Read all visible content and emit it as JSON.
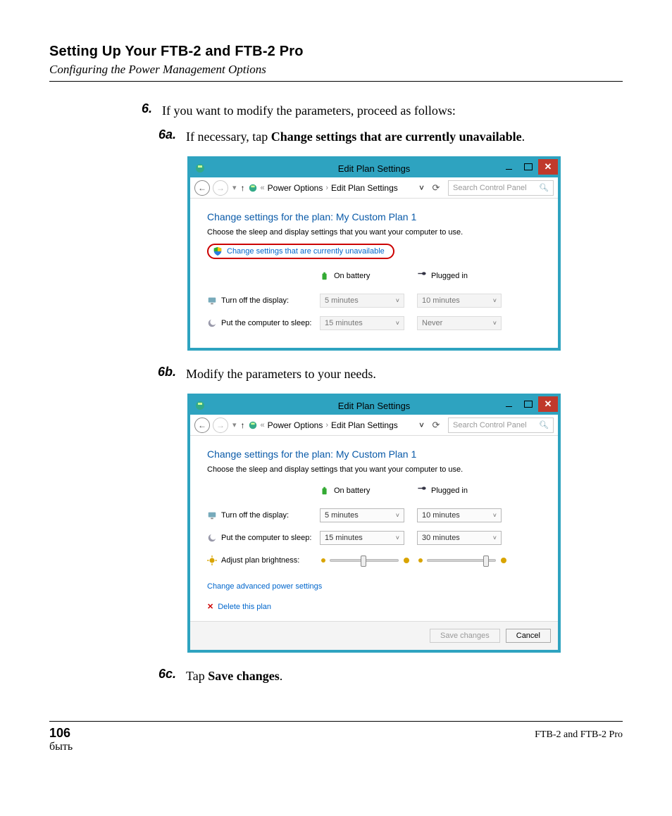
{
  "page_title": "Setting Up Your FTB-2 and FTB-2 Pro",
  "subtitle": "Configuring the Power Management Options",
  "steps": {
    "six_num": "6.",
    "six_text": "If you want to modify the parameters, proceed as follows:",
    "a_num": "6a.",
    "a_lead": "If necessary, tap ",
    "a_bold": "Change settings that are currently unavailable",
    "a_tail": ".",
    "b_num": "6b.",
    "b_text": "Modify the parameters to your needs.",
    "c_num": "6c.",
    "c_lead": "Tap ",
    "c_bold": "Save changes",
    "c_tail": "."
  },
  "win": {
    "title": "Edit Plan Settings",
    "close_glyph": "✕",
    "bc_back": "←",
    "bc_fwd": "→",
    "bc_up": "↑",
    "bc_caret": "«",
    "bc_seg1": "Power Options",
    "bc_seg2": "Edit Plan Settings",
    "bc_sep": "›",
    "bc_dd": "˅",
    "refresh_glyph": "⟳",
    "search_placeholder": "Search Control Panel",
    "search_glyph": "🔍︎",
    "plan_heading": "Change settings for the plan: My Custom Plan 1",
    "plan_desc": "Choose the sleep and display settings that you want your computer to use.",
    "change_unavailable": "Change settings that are currently unavailable",
    "col_battery": "On battery",
    "col_plugged": "Plugged in",
    "row_display": "Turn off the display:",
    "row_sleep": "Put the computer to sleep:",
    "row_brightness": "Adjust plan brightness:",
    "val_5m": "5 minutes",
    "val_10m": "10 minutes",
    "val_15m": "15 minutes",
    "val_30m": "30 minutes",
    "val_never": "Never",
    "advanced": "Change advanced power settings",
    "delete": "Delete this plan",
    "save": "Save changes",
    "cancel": "Cancel"
  },
  "footer": {
    "page_num": "106",
    "product": "FTB-2 and FTB-2 Pro"
  }
}
